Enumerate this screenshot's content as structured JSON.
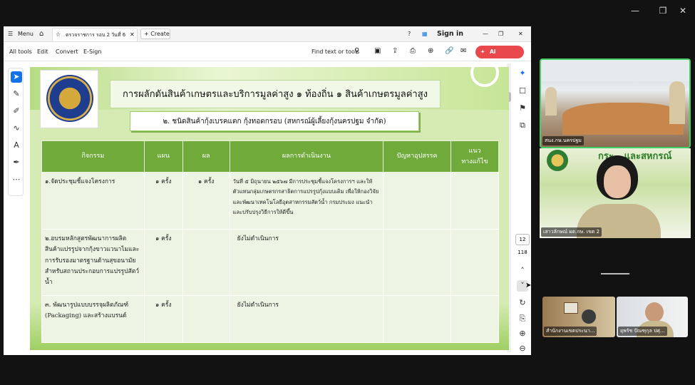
{
  "host": {
    "minimize": "—",
    "restore": "❐",
    "close": "✕"
  },
  "tabbar": {
    "menu_label": "Menu",
    "doc_tab_label": "ตรวจราชการ รอบ 2 วันที่ 6 ตล...",
    "create_label": "Create",
    "sign_in_label": "Sign in"
  },
  "menubar": {
    "items": [
      "All tools",
      "Edit",
      "Convert",
      "E-Sign"
    ],
    "find_label": "Find text or tools",
    "ai_label": "AI Assistant"
  },
  "rail": {
    "page_number": "12",
    "page_total": "118"
  },
  "slide": {
    "title": "การผลักดันสินค้าเกษตรและบริการมูลค่าสูง ๑ ท้องถิ่น ๑ สินค้าเกษตรมูลค่าสูง",
    "subtitle": "๒. ชนิดสินค้ากุ้งเบรคแตก กุ้งทอดกรอบ (สหกรณ์ผู้เลี้ยงกุ้งนครปฐม จำกัด)",
    "headers": [
      "กิจกรรม",
      "แผน",
      "ผล",
      "ผลการดำเนินงาน",
      "ปัญหาอุปสรรค",
      "แนว\nทางแก้ไข"
    ],
    "rows": [
      {
        "activity": "๑.จัดประชุมชี้แจงโครงการ",
        "plan": "๑ ครั้ง",
        "result": "๑ ครั้ง",
        "outcome": "วันที่ ๕ มิถุนายน ๒๕๖๗ มีการประชุมชี้แจงโครงการฯ และให้ตัวแทนกลุ่มเกษตรกรสาธิตการแปรรูปกุ้งแบบเดิม เพื่อให้กองวิจัยและพัฒนาเทคโนโลยีอุตสาหกรรมสัตว์น้ำ กรมประมง แนะนำและปรับปรุงวิธีการให้ดีขึ้น",
        "problem": "",
        "solution": ""
      },
      {
        "activity": "๒.อบรมหลักสูตรพัฒนาการผลิตสินค้าแปรรูปจากกุ้งขาวแวนาไมและการรับรองมาตรฐานด้านสุขอนามัยสำหรับสถานประกอบการแปรรูปสัตว์น้ำ",
        "plan": "๑ ครั้ง",
        "result": "",
        "outcome": "ยังไม่ดำเนินการ",
        "problem": "",
        "solution": ""
      },
      {
        "activity": "๓. พัฒนารูปแบบบรรจุผลิตภัณฑ์ (Packaging) และสร้างแบรนด์",
        "plan": "๑ ครั้ง",
        "result": "",
        "outcome": "ยังไม่ดำเนินการ",
        "problem": "",
        "solution": ""
      }
    ]
  },
  "video": {
    "tile1_label": "สนง.กษ.นครปฐม",
    "tile2_label": "เสาวลักษณ์ ผต.กษ. เขต 2",
    "tile2_banner": "กระ...และสหกรณ์",
    "tile3_label": "สำนักงานเขตประนา...",
    "tile4_label": "ยุพรัช ปัณฑุกุล ปศุ..."
  }
}
